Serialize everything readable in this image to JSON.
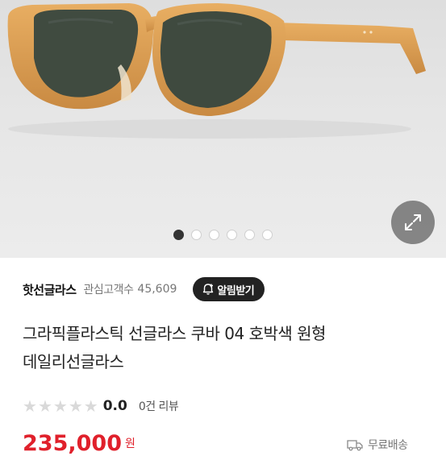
{
  "gallery": {
    "image_alt": "sunglasses product photo",
    "page_indicator": {
      "total": 6,
      "active": 1
    },
    "expand_icon": "expand-arrows-icon"
  },
  "seller": {
    "name": "핫선글라스",
    "favorites_label": "관심고객수",
    "favorites_count": "45,609",
    "alert_button_label": "알림받기",
    "alert_icon": "bell-plus-icon"
  },
  "product": {
    "title_line1": "그라픽플라스틱 선글라스 쿠바 04 호박색 원형",
    "title_line2": "데일리선글라스"
  },
  "rating": {
    "stars_filled": 0,
    "stars_total": 5,
    "score": "0.0",
    "review_text": "0건 리뷰"
  },
  "price": {
    "amount": "235,000",
    "unit": "원"
  },
  "shipping": {
    "label": "무료배송",
    "icon": "truck-icon"
  },
  "colors": {
    "price_red": "#e0202b",
    "frame_amber": "#d99a4e",
    "lens": "#3f4a3f",
    "alert_button_bg": "#222222"
  }
}
